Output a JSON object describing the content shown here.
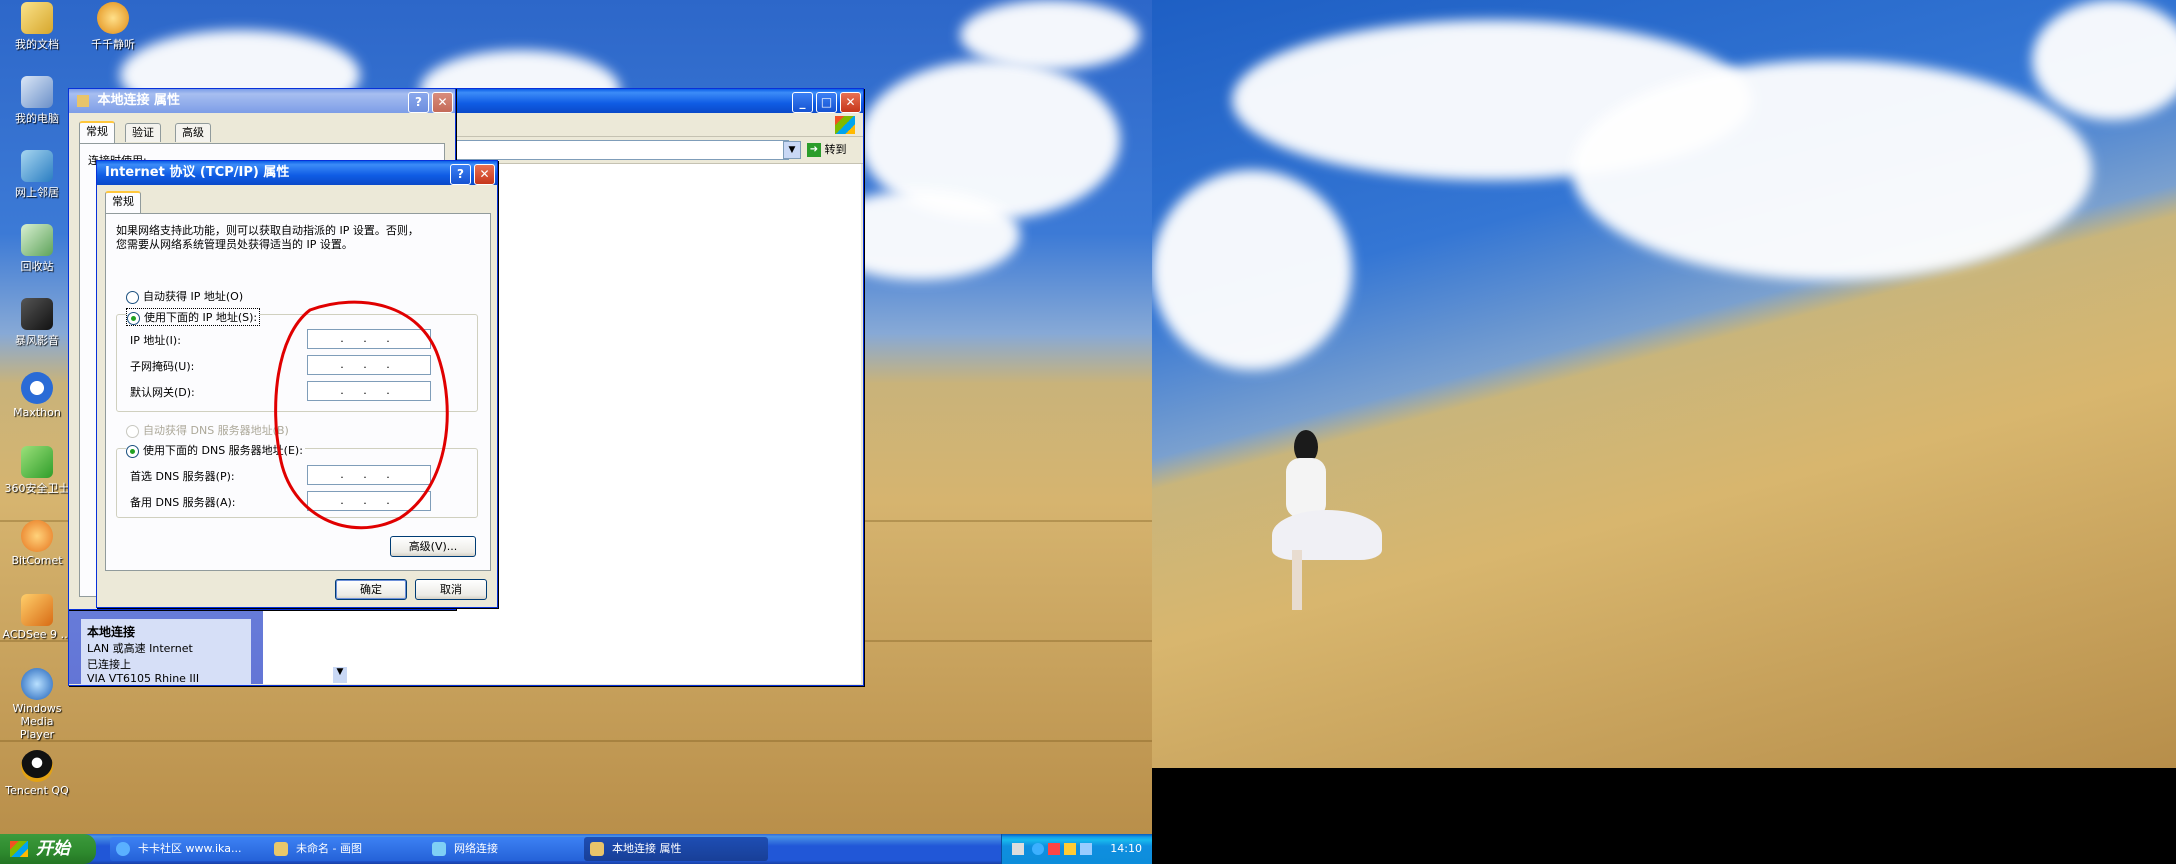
{
  "desktop_icons": [
    {
      "label": "我的文档",
      "icon": "folder-icon"
    },
    {
      "label": "我的电脑",
      "icon": "computer-icon"
    },
    {
      "label": "网上邻居",
      "icon": "network-icon"
    },
    {
      "label": "回收站",
      "icon": "recycle-bin-icon"
    },
    {
      "label": "暴风影音",
      "icon": "media-player-icon"
    },
    {
      "label": "Maxthon",
      "icon": "browser-icon"
    },
    {
      "label": "360安全卫士",
      "icon": "shield-icon"
    },
    {
      "label": "BitComet",
      "icon": "download-icon"
    },
    {
      "label": "ACDSee 9 …",
      "icon": "image-viewer-icon"
    },
    {
      "label": "Windows Media Player",
      "icon": "wmp-icon"
    },
    {
      "label": "Tencent QQ",
      "icon": "qq-icon"
    },
    {
      "label": "千千静听",
      "icon": "music-icon"
    }
  ],
  "explorer_window": {
    "goto_label": "转到",
    "sidebar": {
      "title": "本地连接",
      "line1": "LAN 或高速 Internet",
      "line2": "已连接上",
      "line3": "VIA VT6105 Rhine III"
    }
  },
  "props_window": {
    "title": "本地连接 属性",
    "tabs": [
      "常规",
      "验证",
      "高级"
    ],
    "connect_label": "连接时使用:"
  },
  "tcpip_dialog": {
    "title": "Internet 协议 (TCP/IP) 属性",
    "tab": "常规",
    "description_line1": "如果网络支持此功能，则可以获取自动指派的 IP 设置。否则，",
    "description_line2": "您需要从网络系统管理员处获得适当的 IP 设置。",
    "auto_ip": "自动获得 IP 地址(O)",
    "manual_ip": "使用下面的 IP 地址(S):",
    "ip_address_label": "IP 地址(I):",
    "subnet_label": "子网掩码(U):",
    "gateway_label": "默认网关(D):",
    "auto_dns": "自动获得 DNS 服务器地址(B)",
    "manual_dns": "使用下面的 DNS 服务器地址(E):",
    "preferred_dns_label": "首选 DNS 服务器(P):",
    "alternate_dns_label": "备用 DNS 服务器(A):",
    "ip_placeholder": ". . .",
    "advanced_button": "高级(V)...",
    "ok_button": "确定",
    "cancel_button": "取消",
    "selected_ip_mode": "manual",
    "selected_dns_mode": "manual"
  },
  "annotation": {
    "color": "#e00000",
    "shape": "ellipse"
  },
  "taskbar": {
    "start_label": "开始",
    "items": [
      {
        "label": "卡卡社区 www.ika...",
        "icon": "browser-icon",
        "active": false
      },
      {
        "label": "未命名 - 画图",
        "icon": "paint-icon",
        "active": false
      },
      {
        "label": "网络连接",
        "icon": "network-icon",
        "active": false
      },
      {
        "label": "本地连接 属性",
        "icon": "network-icon",
        "active": true
      }
    ],
    "clock": "14:10"
  }
}
